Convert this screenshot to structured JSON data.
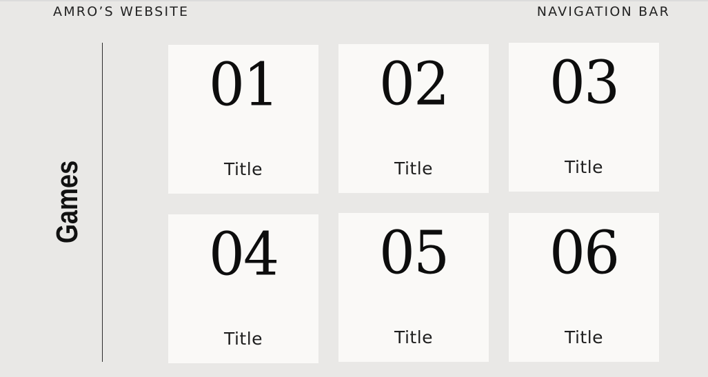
{
  "header": {
    "brand": "AMRO’S WEBSITE",
    "nav_label": "NAVIGATION BAR"
  },
  "section": {
    "title": "Games"
  },
  "cards": [
    {
      "number": "01",
      "title": "Title"
    },
    {
      "number": "02",
      "title": "Title"
    },
    {
      "number": "03",
      "title": "Title"
    },
    {
      "number": "04",
      "title": "Title"
    },
    {
      "number": "05",
      "title": "Title"
    },
    {
      "number": "06",
      "title": "Title"
    }
  ],
  "colors": {
    "background": "#e9e8e6",
    "card": "#faf9f7",
    "text": "#1b1b1b"
  }
}
